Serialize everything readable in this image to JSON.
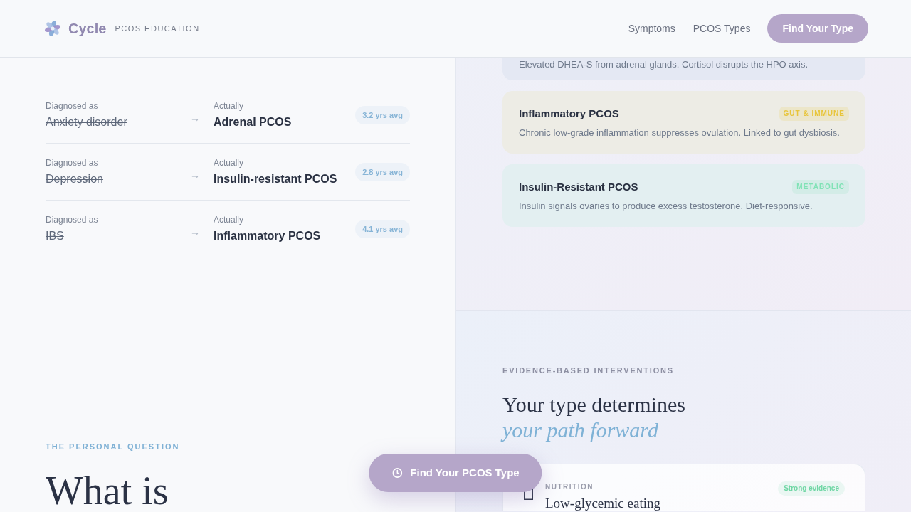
{
  "header": {
    "brand": "Cycle",
    "tagline": "PCOS EDUCATION",
    "nav_links": [
      "Symptoms",
      "PCOS Types"
    ],
    "cta": "Find Your Type"
  },
  "misdiagnoses": [
    {
      "diagnosed_label": "Diagnosed as",
      "diagnosis": "Anxiety disorder",
      "arrow": "→",
      "actual_label": "Actually",
      "actual_type": "Adrenal PCOS",
      "delay": "3.2 yrs avg"
    },
    {
      "diagnosed_label": "Diagnosed as",
      "diagnosis": "Depression",
      "arrow": "→",
      "actual_label": "Actually",
      "actual_type": "Insulin-resistant PCOS",
      "delay": "2.8 yrs avg"
    },
    {
      "diagnosed_label": "Diagnosed as",
      "diagnosis": "IBS",
      "arrow": "→",
      "actual_label": "Actually",
      "actual_type": "Inflammatory PCOS",
      "delay": "4.1 yrs avg"
    }
  ],
  "personal_question": {
    "eyebrow": "THE PERSONAL QUESTION",
    "heading": "What is"
  },
  "pcos_types": [
    {
      "description": "Elevated DHEA-S from adrenal glands. Cortisol disrupts the HPO axis."
    },
    {
      "name": "Inflammatory PCOS",
      "tag": "GUT & IMMUNE",
      "color": "#e8c53a",
      "description": "Chronic low-grade inflammation suppresses ovulation. Linked to gut dysbiosis."
    },
    {
      "name": "Insulin-Resistant PCOS",
      "tag": "METABOLIC",
      "color": "#80e2b6",
      "description": "Insulin signals ovaries to produce excess testosterone. Diet-responsive."
    }
  ],
  "interventions": {
    "eyebrow": "EVIDENCE-BASED INTERVENTIONS",
    "heading": "Your type determines",
    "heading_accent": "your path forward",
    "items": [
      {
        "category": "NUTRITION",
        "evidence": "Strong evidence",
        "color": "#6fd6a4",
        "title": "Low-glycemic eating"
      }
    ]
  },
  "floating_button": {
    "label": "Find Your PCOS Type"
  }
}
